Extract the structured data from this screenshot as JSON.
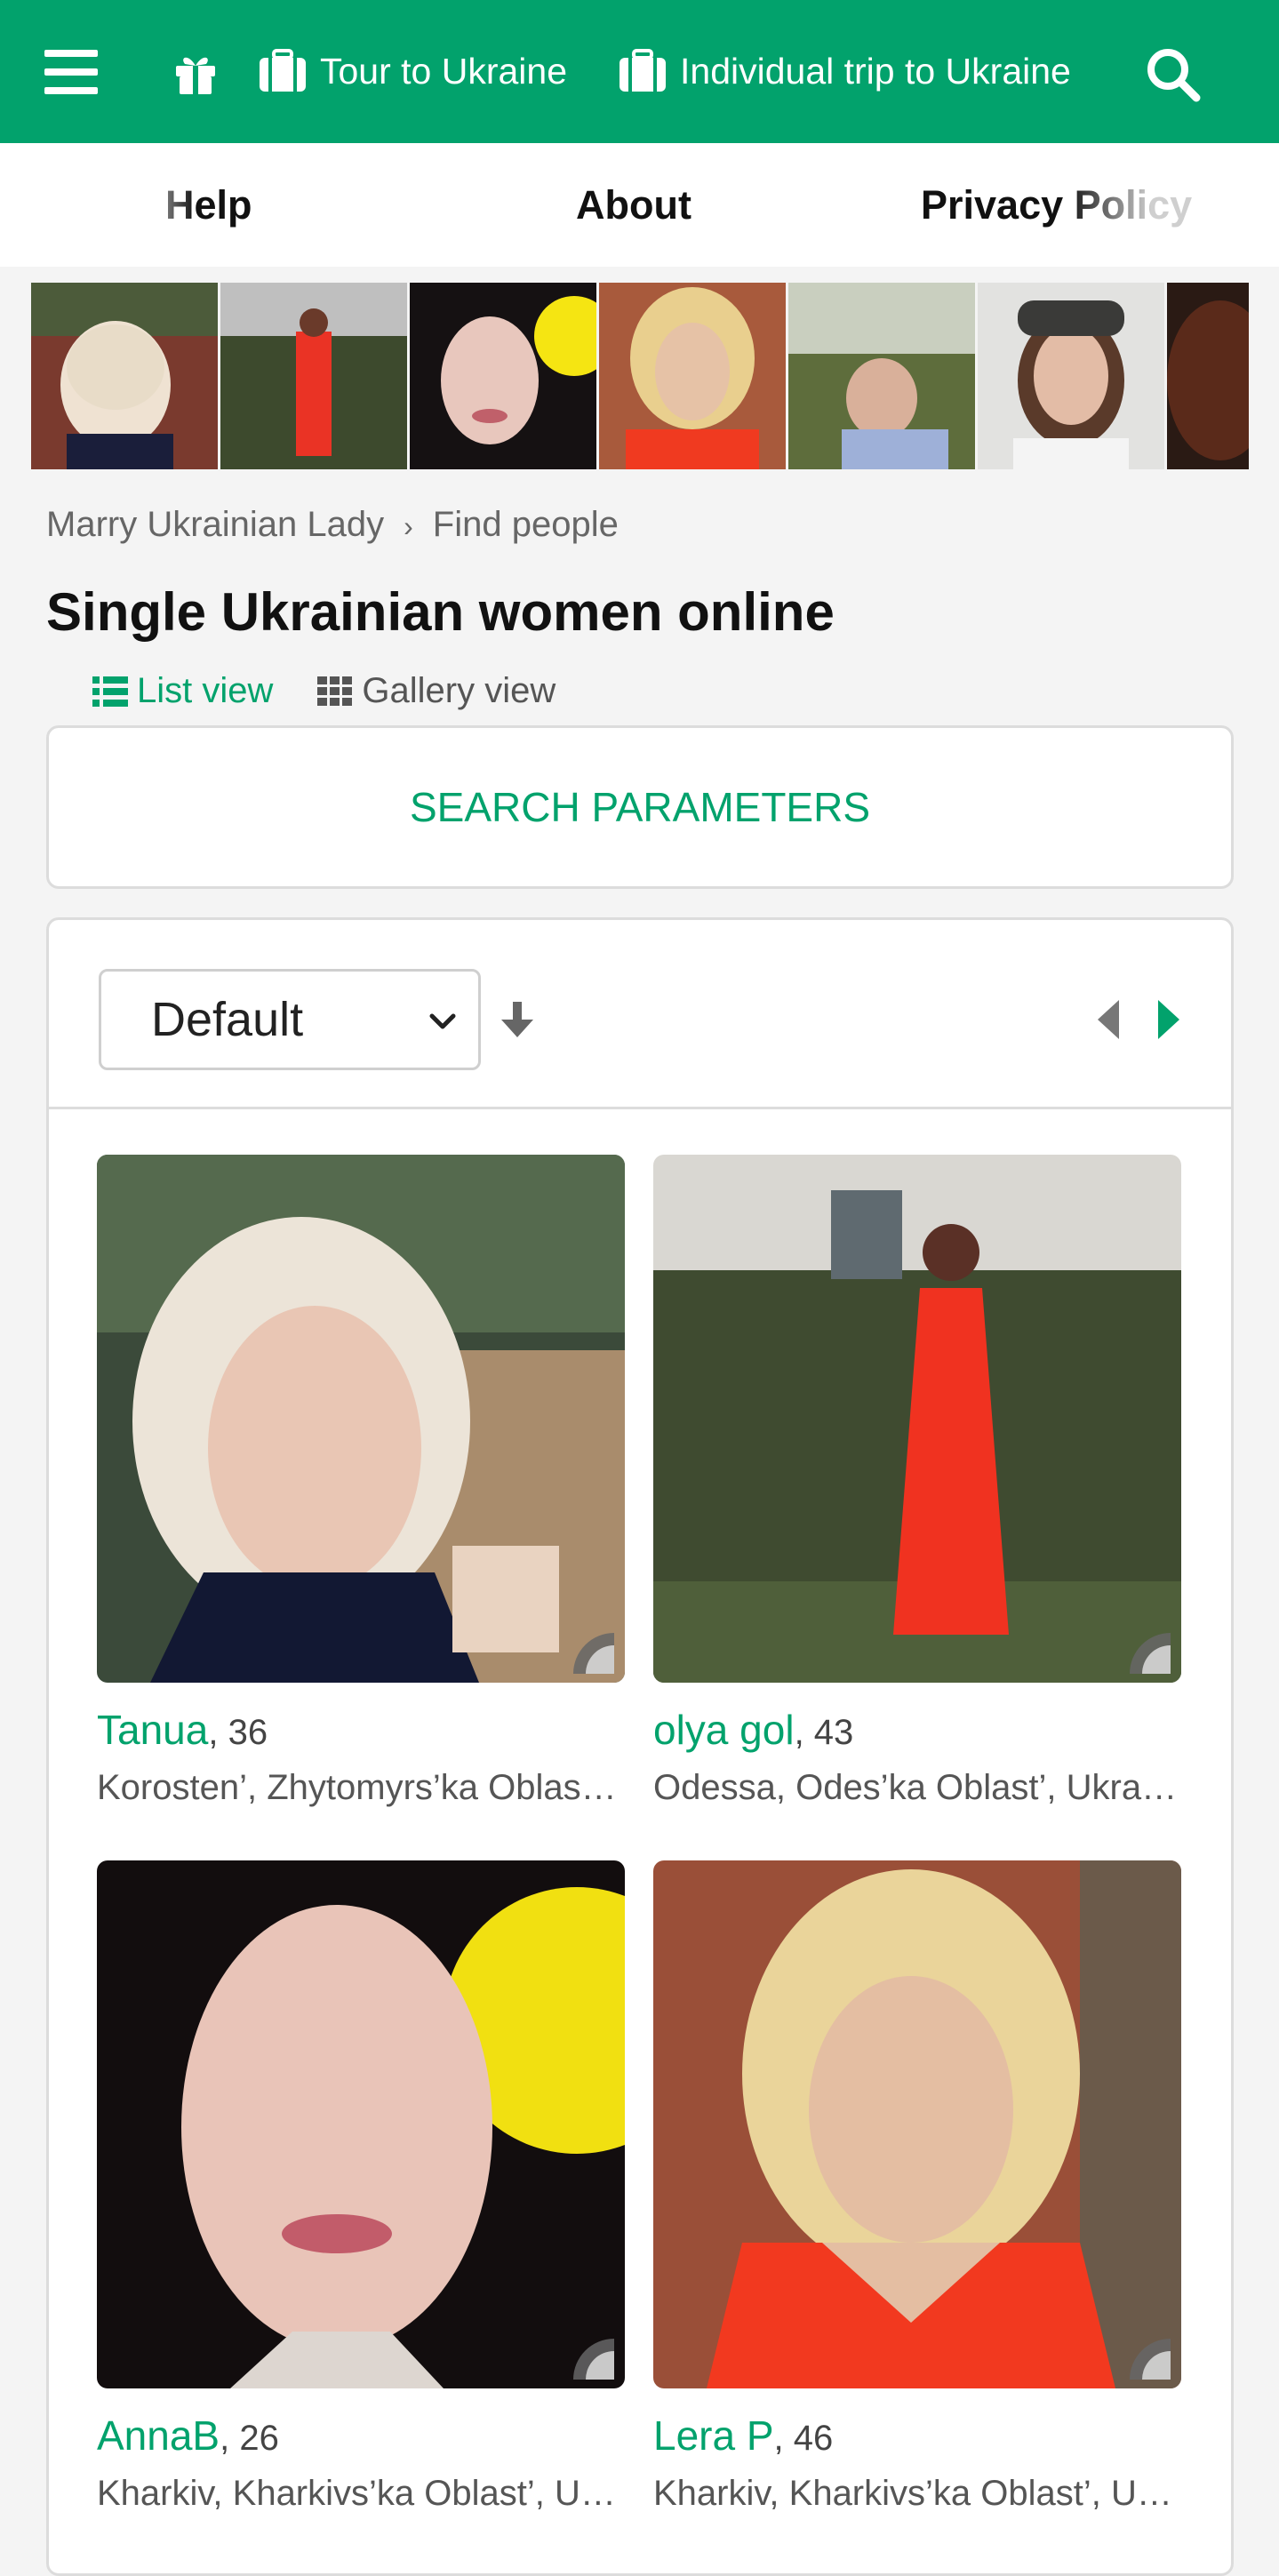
{
  "topbar": {
    "tour_label": "Tour to Ukraine",
    "individual_label": "Individual trip to Ukraine",
    "accent": "#02a26c"
  },
  "subnav": {
    "help": "Help",
    "about": "About",
    "privacy": "Privacy Policy"
  },
  "breadcrumb": {
    "home": "Marry Ukrainian Lady",
    "current": "Find people"
  },
  "page": {
    "title": "Single Ukrainian women online"
  },
  "views": {
    "list": "List view",
    "gallery": "Gallery view"
  },
  "search_params": "SEARCH PARAMETERS",
  "sort": {
    "selected": "Default"
  },
  "profiles": [
    {
      "name": "Tanua",
      "age": ", 36",
      "location": "Korosten’, Zhytomyrs’ka Oblast’, Ukraine"
    },
    {
      "name": "olya gol",
      "age": ", 43",
      "location": "Odessa, Odes’ka Oblast’, Ukraine"
    },
    {
      "name": "AnnaB",
      "age": ", 26",
      "location": "Kharkiv, Kharkivs’ka Oblast’, Ukraine"
    },
    {
      "name": "Lera P",
      "age": ", 46",
      "location": "Kharkiv, Kharkivs’ka Oblast’, Ukraine"
    }
  ]
}
